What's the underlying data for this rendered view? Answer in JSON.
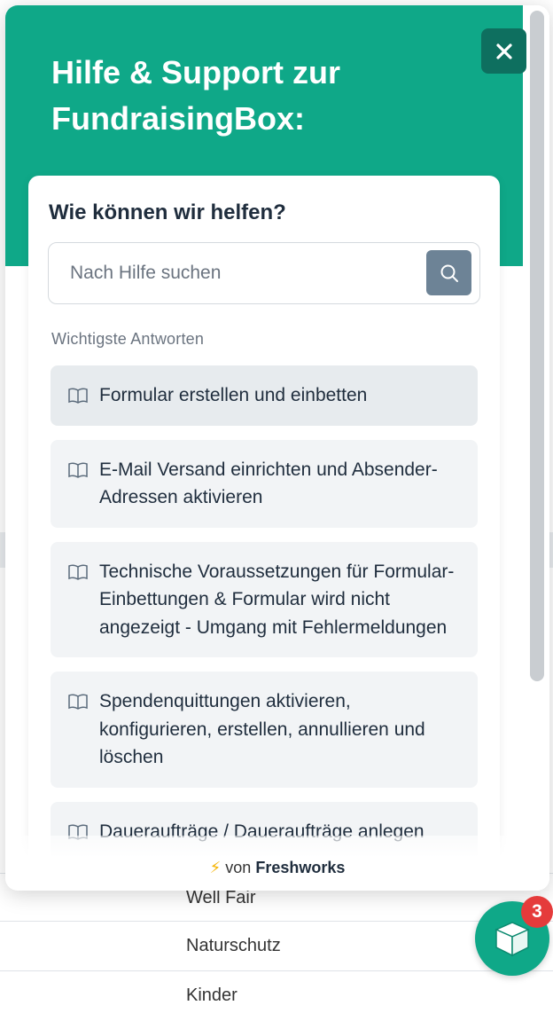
{
  "widget": {
    "title": "Hilfe & Support zur FundraisingBox:",
    "close_icon": "close-icon",
    "card_title": "Wie können wir helfen?",
    "search": {
      "placeholder": "Nach Hilfe suchen",
      "value": "",
      "icon": "search-icon"
    },
    "section_label": "Wichtigste Antworten",
    "articles": [
      {
        "label": "Formular erstellen und einbetten",
        "icon": "book-icon"
      },
      {
        "label": "E-Mail Versand einrichten und Absender-Adressen aktivieren",
        "icon": "book-icon"
      },
      {
        "label": "Technische Voraussetzungen für Formular-Einbettungen & Formular wird nicht angezeigt - Umgang mit Fehlermeldungen",
        "icon": "book-icon"
      },
      {
        "label": "Spendenquittungen aktivieren, konfigurieren, erstellen, annullieren und löschen",
        "icon": "book-icon"
      },
      {
        "label": "Daueraufträge / Daueraufträge anlegen",
        "icon": "book-icon"
      }
    ],
    "powered_prefix": "von",
    "powered_brand": "Freshworks"
  },
  "background": {
    "rows": [
      "Well Fair",
      "Naturschutz",
      "Kinder"
    ]
  },
  "launcher": {
    "badge_count": "3",
    "icon": "box-icon"
  },
  "colors": {
    "brand": "#0fa888",
    "close_bg": "#0e6f5f",
    "search_button": "#6d8396",
    "badge": "#e53b3b"
  }
}
